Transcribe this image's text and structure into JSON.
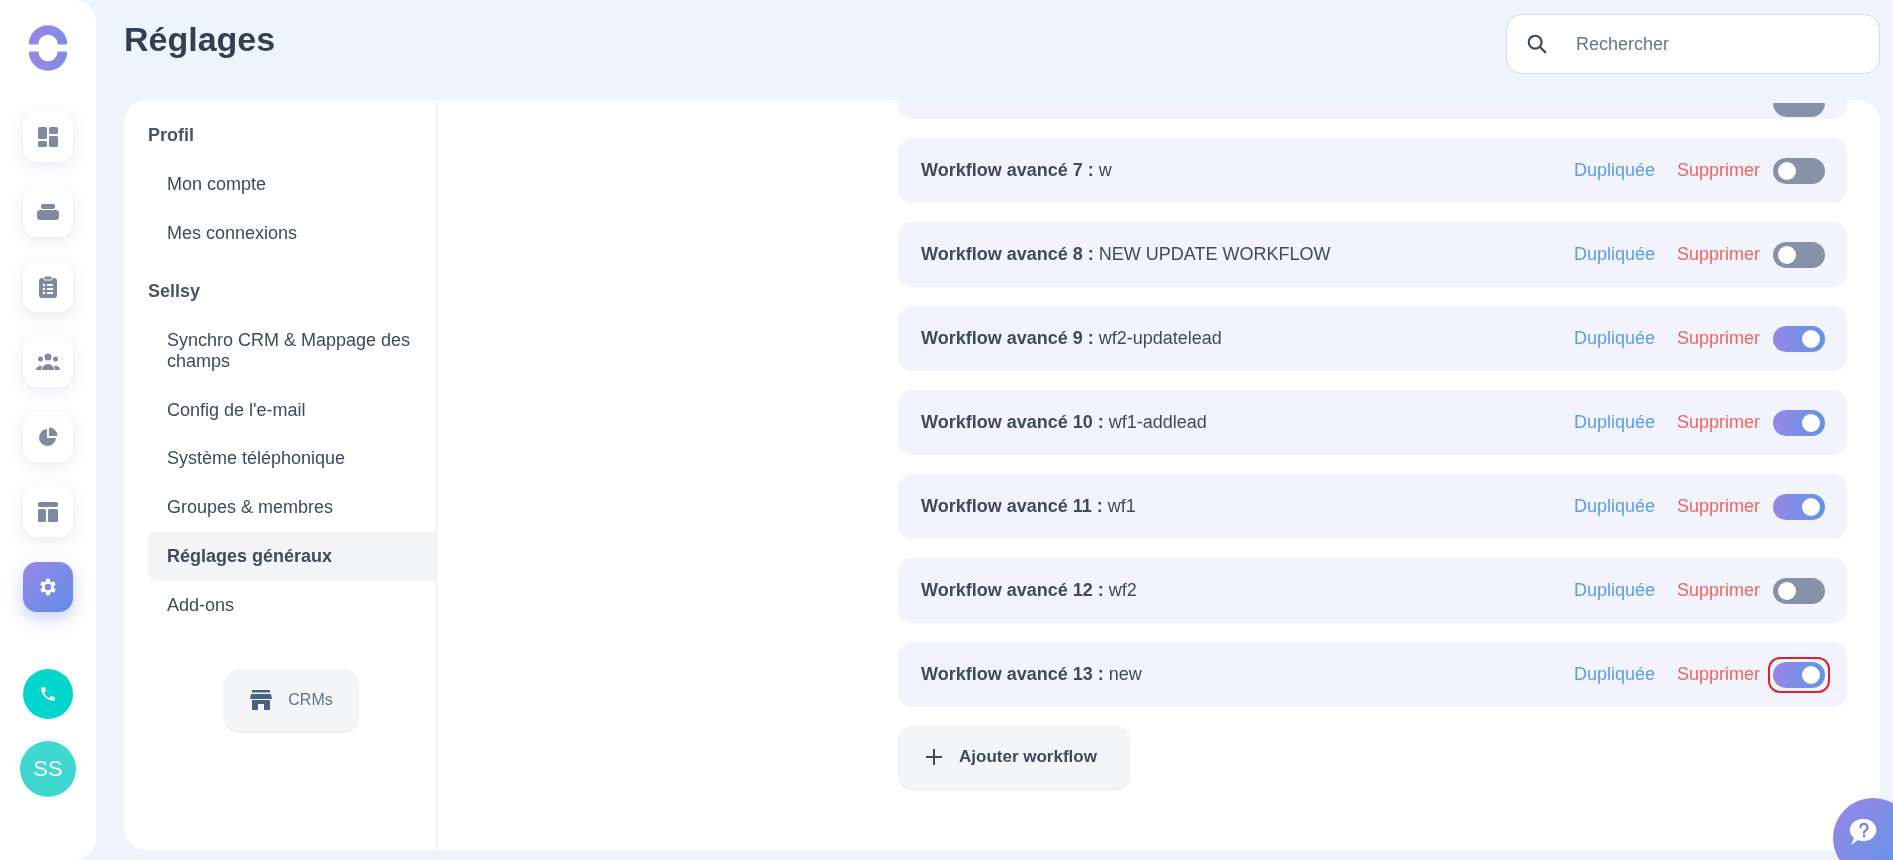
{
  "rail": {
    "items": [
      {
        "kind": "dashboard",
        "selected": false
      },
      {
        "kind": "stack",
        "selected": false
      },
      {
        "kind": "clipboard",
        "selected": false
      },
      {
        "kind": "team",
        "selected": false
      },
      {
        "kind": "pie",
        "selected": false
      },
      {
        "kind": "layout",
        "selected": false
      },
      {
        "kind": "settings",
        "selected": true
      }
    ],
    "avatar": "SS"
  },
  "header": {
    "title": "Réglages",
    "search": {
      "placeholder": "Rechercher"
    }
  },
  "nav": {
    "sections": [
      {
        "title": "Profil",
        "items": [
          {
            "label": "Mon compte",
            "selected": false
          },
          {
            "label": "Mes connexions",
            "selected": false
          }
        ]
      },
      {
        "title": "Sellsy",
        "items": [
          {
            "label": "Synchro CRM & Mappage des champs",
            "selected": false
          },
          {
            "label": "Config de l'e-mail",
            "selected": false
          },
          {
            "label": "Système téléphonique",
            "selected": false
          },
          {
            "label": "Groupes & membres",
            "selected": false
          },
          {
            "label": "Réglages généraux",
            "selected": true
          },
          {
            "label": "Add-ons",
            "selected": false
          }
        ]
      }
    ],
    "crms_button": "CRMs"
  },
  "workflows": {
    "partial_row": {
      "on": false
    },
    "rows": [
      {
        "title": "**Workflow avancé 7 :** w",
        "duplicate": "Dupliquée",
        "delete": "Supprimer",
        "on": false,
        "highlighted": false
      },
      {
        "title": "**Workflow avancé 8 :** NEW UPDATE WORKFLOW",
        "duplicate": "Dupliquée",
        "delete": "Supprimer",
        "on": false,
        "highlighted": false
      },
      {
        "title": "**Workflow avancé 9 :** wf2-updatelead",
        "duplicate": "Dupliquée",
        "delete": "Supprimer",
        "on": true,
        "highlighted": false
      },
      {
        "title": "**Workflow avancé 10 :** wf1-addlead",
        "duplicate": "Dupliquée",
        "delete": "Supprimer",
        "on": true,
        "highlighted": false
      },
      {
        "title": "**Workflow avancé 11 :** wf1",
        "duplicate": "Dupliquée",
        "delete": "Supprimer",
        "on": true,
        "highlighted": false
      },
      {
        "title": "**Workflow avancé 12 :** wf2",
        "duplicate": "Dupliquée",
        "delete": "Supprimer",
        "on": false,
        "highlighted": false
      },
      {
        "title": "**Workflow avancé 13 :** new",
        "duplicate": "Dupliquée",
        "delete": "Supprimer",
        "on": true,
        "highlighted": true
      }
    ],
    "add_button": "Ajouter workflow"
  }
}
